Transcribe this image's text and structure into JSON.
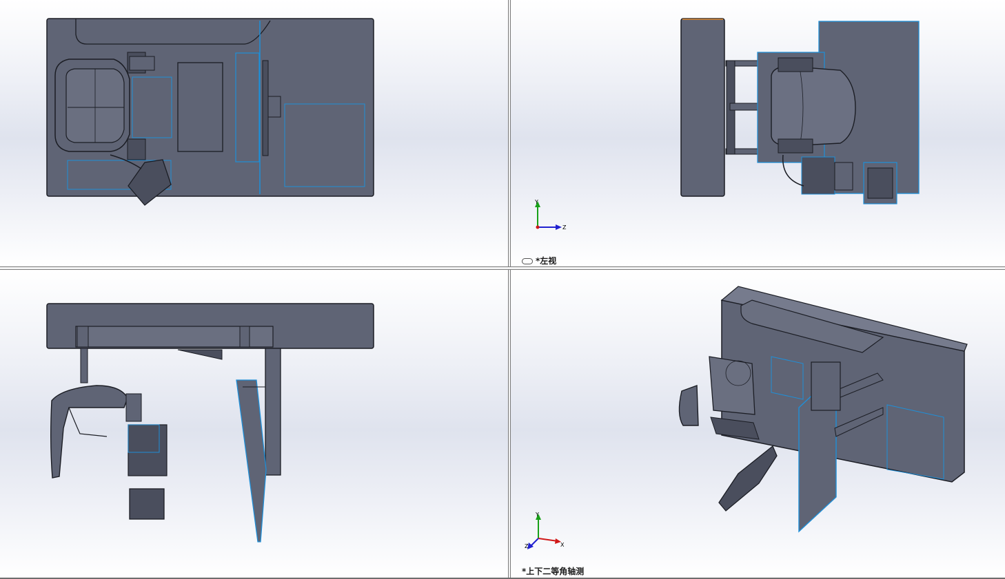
{
  "viewports": {
    "top_left": {
      "label": ""
    },
    "top_right": {
      "label_prefix": "*",
      "label": "左视",
      "link_icon": "link-icon"
    },
    "bottom_left": {
      "label": ""
    },
    "bottom_right": {
      "label_prefix": "*",
      "label": "上下二等角轴测"
    }
  },
  "triad_left_view": {
    "axis_y": "Y",
    "axis_z": "Z",
    "colors": {
      "y": "#18a018",
      "z": "#2020d0",
      "x": "#d01818"
    }
  },
  "triad_iso_view": {
    "axis_y": "Y",
    "axis_x": "X",
    "axis_z": "Z"
  },
  "colors": {
    "body": "#5f6475",
    "edge": "#1b1d24",
    "highlight": "#1f8fd8",
    "accent": "#e08a2c"
  }
}
